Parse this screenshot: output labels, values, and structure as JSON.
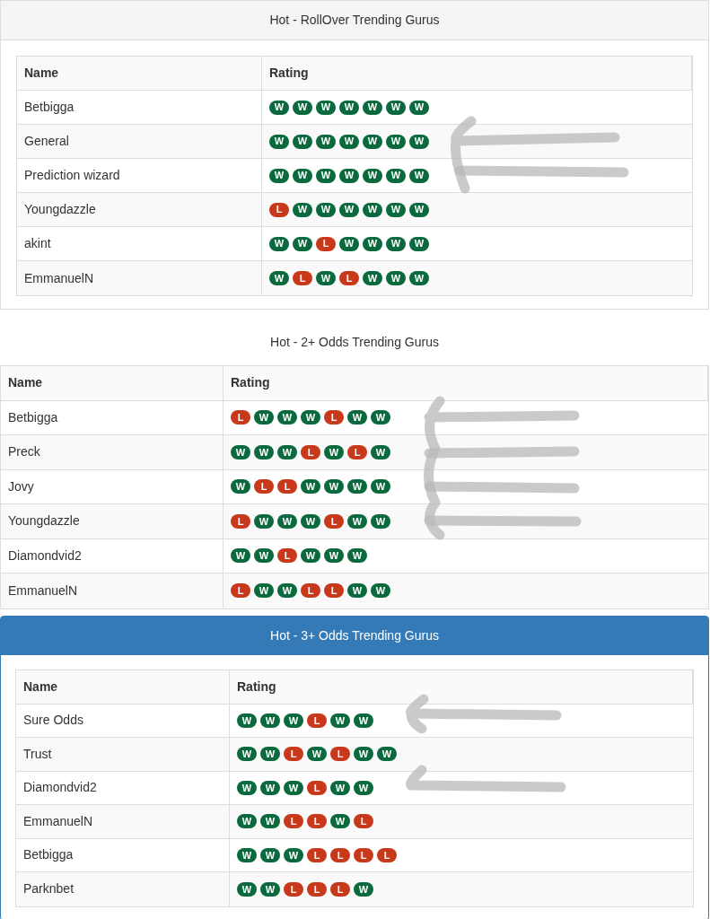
{
  "panels": [
    {
      "kind": "default",
      "title": "Hot - RollOver Trending Gurus",
      "columns": [
        "Name",
        "Rating"
      ],
      "rows": [
        {
          "name": "Betbigga",
          "results": [
            {
              "kind": "win",
              "label": "W"
            },
            {
              "kind": "win",
              "label": "W"
            },
            {
              "kind": "win",
              "label": "W"
            },
            {
              "kind": "win",
              "label": "W"
            },
            {
              "kind": "win",
              "label": "W"
            },
            {
              "kind": "win",
              "label": "W"
            },
            {
              "kind": "win",
              "label": "W"
            }
          ]
        },
        {
          "name": "General",
          "results": [
            {
              "kind": "win",
              "label": "W"
            },
            {
              "kind": "win",
              "label": "W"
            },
            {
              "kind": "win",
              "label": "W"
            },
            {
              "kind": "win",
              "label": "W"
            },
            {
              "kind": "win",
              "label": "W"
            },
            {
              "kind": "win",
              "label": "W"
            },
            {
              "kind": "win",
              "label": "W"
            }
          ]
        },
        {
          "name": "Prediction wizard",
          "results": [
            {
              "kind": "win",
              "label": "W"
            },
            {
              "kind": "win",
              "label": "W"
            },
            {
              "kind": "win",
              "label": "W"
            },
            {
              "kind": "win",
              "label": "W"
            },
            {
              "kind": "win",
              "label": "W"
            },
            {
              "kind": "win",
              "label": "W"
            },
            {
              "kind": "win",
              "label": "W"
            }
          ]
        },
        {
          "name": "Youngdazzle",
          "results": [
            {
              "kind": "loss",
              "label": "L"
            },
            {
              "kind": "win",
              "label": "W"
            },
            {
              "kind": "win",
              "label": "W"
            },
            {
              "kind": "win",
              "label": "W"
            },
            {
              "kind": "win",
              "label": "W"
            },
            {
              "kind": "win",
              "label": "W"
            },
            {
              "kind": "win",
              "label": "W"
            }
          ]
        },
        {
          "name": "akint",
          "results": [
            {
              "kind": "win",
              "label": "W"
            },
            {
              "kind": "win",
              "label": "W"
            },
            {
              "kind": "loss",
              "label": "L"
            },
            {
              "kind": "win",
              "label": "W"
            },
            {
              "kind": "win",
              "label": "W"
            },
            {
              "kind": "win",
              "label": "W"
            },
            {
              "kind": "win",
              "label": "W"
            }
          ]
        },
        {
          "name": "EmmanuelN",
          "results": [
            {
              "kind": "win",
              "label": "W"
            },
            {
              "kind": "loss",
              "label": "L"
            },
            {
              "kind": "win",
              "label": "W"
            },
            {
              "kind": "loss",
              "label": "L"
            },
            {
              "kind": "win",
              "label": "W"
            },
            {
              "kind": "win",
              "label": "W"
            },
            {
              "kind": "win",
              "label": "W"
            }
          ]
        }
      ]
    },
    {
      "kind": "plain",
      "title": "Hot - 2+ Odds Trending Gurus",
      "columns": [
        "Name",
        "Rating"
      ],
      "rows": [
        {
          "name": "Betbigga",
          "results": [
            {
              "kind": "loss",
              "label": "L"
            },
            {
              "kind": "win",
              "label": "W"
            },
            {
              "kind": "win",
              "label": "W"
            },
            {
              "kind": "win",
              "label": "W"
            },
            {
              "kind": "loss",
              "label": "L"
            },
            {
              "kind": "win",
              "label": "W"
            },
            {
              "kind": "win",
              "label": "W"
            }
          ]
        },
        {
          "name": "Preck",
          "results": [
            {
              "kind": "win",
              "label": "W"
            },
            {
              "kind": "win",
              "label": "W"
            },
            {
              "kind": "win",
              "label": "W"
            },
            {
              "kind": "loss",
              "label": "L"
            },
            {
              "kind": "win",
              "label": "W"
            },
            {
              "kind": "loss",
              "label": "L"
            },
            {
              "kind": "win",
              "label": "W"
            }
          ]
        },
        {
          "name": "Jovy",
          "results": [
            {
              "kind": "win",
              "label": "W"
            },
            {
              "kind": "loss",
              "label": "L"
            },
            {
              "kind": "loss",
              "label": "L"
            },
            {
              "kind": "win",
              "label": "W"
            },
            {
              "kind": "win",
              "label": "W"
            },
            {
              "kind": "win",
              "label": "W"
            },
            {
              "kind": "win",
              "label": "W"
            }
          ]
        },
        {
          "name": "Youngdazzle",
          "results": [
            {
              "kind": "loss",
              "label": "L"
            },
            {
              "kind": "win",
              "label": "W"
            },
            {
              "kind": "win",
              "label": "W"
            },
            {
              "kind": "win",
              "label": "W"
            },
            {
              "kind": "loss",
              "label": "L"
            },
            {
              "kind": "win",
              "label": "W"
            },
            {
              "kind": "win",
              "label": "W"
            }
          ]
        },
        {
          "name": "Diamondvid2",
          "results": [
            {
              "kind": "win",
              "label": "W"
            },
            {
              "kind": "win",
              "label": "W"
            },
            {
              "kind": "loss",
              "label": "L"
            },
            {
              "kind": "win",
              "label": "W"
            },
            {
              "kind": "win",
              "label": "W"
            },
            {
              "kind": "win",
              "label": "W"
            }
          ]
        },
        {
          "name": "EmmanuelN",
          "results": [
            {
              "kind": "loss",
              "label": "L"
            },
            {
              "kind": "win",
              "label": "W"
            },
            {
              "kind": "win",
              "label": "W"
            },
            {
              "kind": "loss",
              "label": "L"
            },
            {
              "kind": "loss",
              "label": "L"
            },
            {
              "kind": "win",
              "label": "W"
            },
            {
              "kind": "win",
              "label": "W"
            }
          ]
        }
      ]
    },
    {
      "kind": "primary",
      "title": "Hot - 3+ Odds Trending Gurus",
      "columns": [
        "Name",
        "Rating"
      ],
      "rows": [
        {
          "name": "Sure Odds",
          "results": [
            {
              "kind": "win",
              "label": "W"
            },
            {
              "kind": "win",
              "label": "W"
            },
            {
              "kind": "win",
              "label": "W"
            },
            {
              "kind": "loss",
              "label": "L"
            },
            {
              "kind": "win",
              "label": "W"
            },
            {
              "kind": "win",
              "label": "W"
            }
          ]
        },
        {
          "name": "Trust",
          "results": [
            {
              "kind": "win",
              "label": "W"
            },
            {
              "kind": "win",
              "label": "W"
            },
            {
              "kind": "loss",
              "label": "L"
            },
            {
              "kind": "win",
              "label": "W"
            },
            {
              "kind": "loss",
              "label": "L"
            },
            {
              "kind": "win",
              "label": "W"
            },
            {
              "kind": "win",
              "label": "W"
            }
          ]
        },
        {
          "name": "Diamondvid2",
          "results": [
            {
              "kind": "win",
              "label": "W"
            },
            {
              "kind": "win",
              "label": "W"
            },
            {
              "kind": "win",
              "label": "W"
            },
            {
              "kind": "loss",
              "label": "L"
            },
            {
              "kind": "win",
              "label": "W"
            },
            {
              "kind": "win",
              "label": "W"
            }
          ]
        },
        {
          "name": "EmmanuelN",
          "results": [
            {
              "kind": "win",
              "label": "W"
            },
            {
              "kind": "win",
              "label": "W"
            },
            {
              "kind": "loss",
              "label": "L"
            },
            {
              "kind": "loss",
              "label": "L"
            },
            {
              "kind": "win",
              "label": "W"
            },
            {
              "kind": "loss",
              "label": "L"
            }
          ]
        },
        {
          "name": "Betbigga",
          "results": [
            {
              "kind": "win",
              "label": "W"
            },
            {
              "kind": "win",
              "label": "W"
            },
            {
              "kind": "win",
              "label": "W"
            },
            {
              "kind": "loss",
              "label": "L"
            },
            {
              "kind": "loss",
              "label": "L"
            },
            {
              "kind": "loss",
              "label": "L"
            },
            {
              "kind": "loss",
              "label": "L"
            }
          ]
        },
        {
          "name": "Parknbet",
          "results": [
            {
              "kind": "win",
              "label": "W"
            },
            {
              "kind": "win",
              "label": "W"
            },
            {
              "kind": "loss",
              "label": "L"
            },
            {
              "kind": "loss",
              "label": "L"
            },
            {
              "kind": "loss",
              "label": "L"
            },
            {
              "kind": "win",
              "label": "W"
            }
          ]
        }
      ]
    }
  ]
}
